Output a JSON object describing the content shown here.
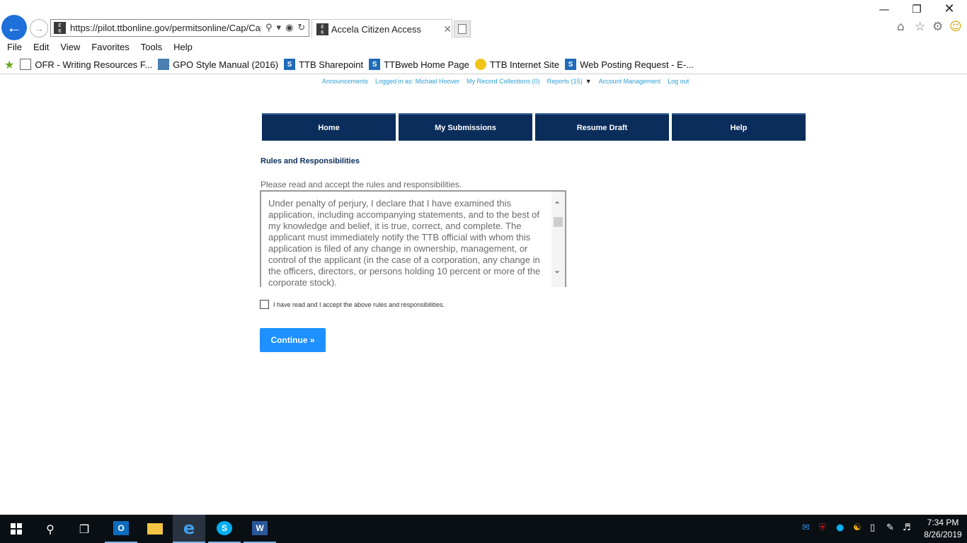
{
  "browser": {
    "url": "https://pilot.ttbonline.gov/permitsonline/Cap/Cap.",
    "tab_title": "Accela Citizen Access",
    "site_badge": "EAP 6"
  },
  "menu": [
    "File",
    "Edit",
    "View",
    "Favorites",
    "Tools",
    "Help"
  ],
  "favorites": [
    {
      "label": "OFR - Writing Resources F...",
      "icon": "document-icon"
    },
    {
      "label": "GPO Style Manual (2016)",
      "icon": "gpo-icon"
    },
    {
      "label": "TTB Sharepoint",
      "icon": "sharepoint-icon"
    },
    {
      "label": "TTBweb Home Page",
      "icon": "sharepoint-icon"
    },
    {
      "label": "TTB Internet Site",
      "icon": "ttb-seal-icon"
    },
    {
      "label": "Web Posting Request - E-...",
      "icon": "sharepoint-icon"
    }
  ],
  "utility_bar": {
    "announcements": "Announcements",
    "logged_in": "Logged in as: Michael Hoover",
    "record_collections": "My Record Collections (0)",
    "reports": "Reports (15)",
    "account_management": "Account Management",
    "logout": "Log out"
  },
  "nav_tabs": [
    "Home",
    "My Submissions",
    "Resume Draft",
    "Help"
  ],
  "page": {
    "section_title": "Rules and Responsibilities",
    "instructions": "Please read and accept the rules and responsibilities.",
    "rules_text": "Under penalty of perjury, I declare that I have examined this application, including accompanying statements, and to the best of my knowledge and belief, it is true, correct, and complete. The applicant must immediately notify the TTB official with whom this application is filed of any change in ownership, management, or control of the applicant (in the case of a corporation, any change in the officers, directors, or persons holding 10 percent or more of the corporate stock).",
    "accept_label": "I have read and I accept the above rules and responsibilities.",
    "accept_checked": false,
    "continue_label": "Continue »"
  },
  "taskbar": {
    "time": "7:34 PM",
    "date": "8/26/2019"
  },
  "colors": {
    "nav_tab_bg": "#0b2d5b",
    "link": "#2f9fd8",
    "continue_bg": "#1e90ff",
    "taskbar_bg": "#0a0f14"
  }
}
